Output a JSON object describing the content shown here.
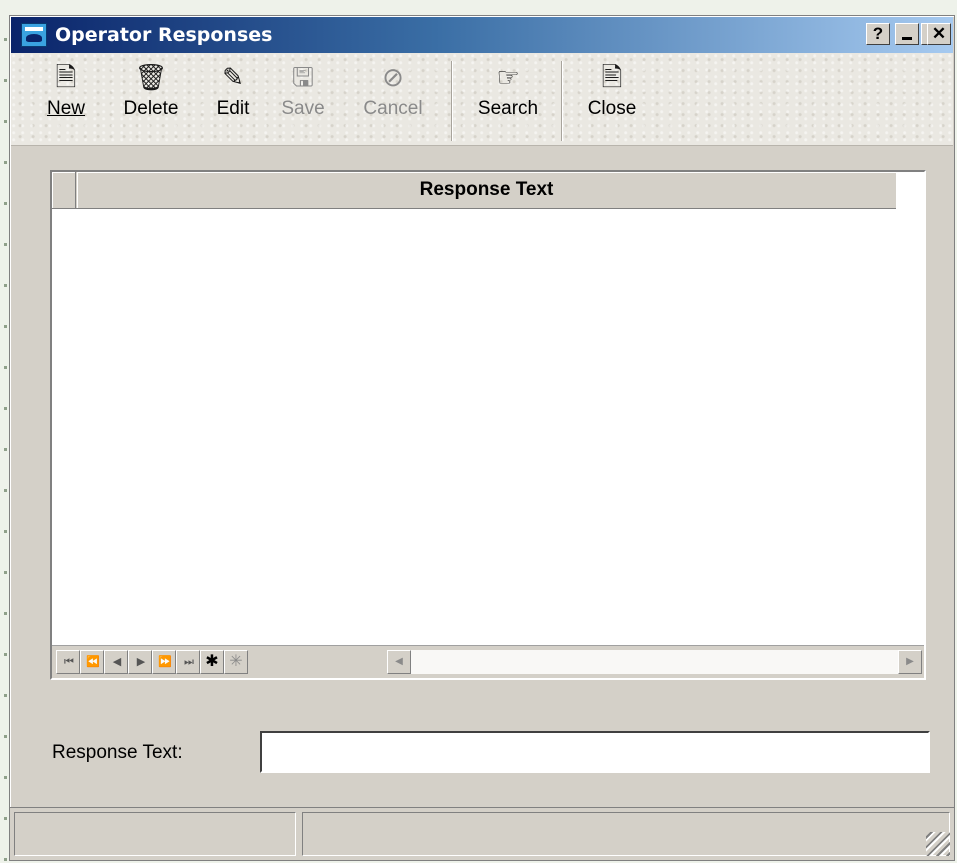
{
  "window": {
    "title": "Operator Responses",
    "caption_buttons": {
      "help": "?",
      "minimize": "_",
      "maximize": "□",
      "close": "✕"
    }
  },
  "toolbar": {
    "new": {
      "label": "New",
      "icon": "new-document-icon",
      "glyph": "🗎",
      "enabled": true
    },
    "delete": {
      "label": "Delete",
      "icon": "trash-icon",
      "glyph": "🗑",
      "enabled": true
    },
    "edit": {
      "label": "Edit",
      "icon": "edit-document-icon",
      "glyph": "✎",
      "enabled": true
    },
    "save": {
      "label": "Save",
      "icon": "save-icon",
      "glyph": "🖫",
      "enabled": false
    },
    "cancel": {
      "label": "Cancel",
      "icon": "cancel-icon",
      "glyph": "⊘",
      "enabled": false
    },
    "search": {
      "label": "Search",
      "icon": "pointing-hand-search-icon",
      "glyph": "☞",
      "enabled": true
    },
    "close": {
      "label": "Close",
      "icon": "close-document-icon",
      "glyph": "🖹",
      "enabled": true
    }
  },
  "grid": {
    "columns": [
      "Response Text"
    ],
    "rows": [],
    "nav_buttons": [
      {
        "name": "first-record",
        "glyph": "⏮"
      },
      {
        "name": "previous-page",
        "glyph": "⏪"
      },
      {
        "name": "previous-record",
        "glyph": "◀"
      },
      {
        "name": "next-record",
        "glyph": "▶"
      },
      {
        "name": "next-page",
        "glyph": "⏩"
      },
      {
        "name": "last-record",
        "glyph": "⏭"
      },
      {
        "name": "new-record",
        "glyph": "✱"
      },
      {
        "name": "new-record-disabled",
        "glyph": "✳"
      }
    ],
    "scroll_left": "◀",
    "scroll_right": "▶"
  },
  "form": {
    "response_label": "Response Text:",
    "response_value": ""
  },
  "statusbar": {
    "pane1": "",
    "pane2": ""
  }
}
